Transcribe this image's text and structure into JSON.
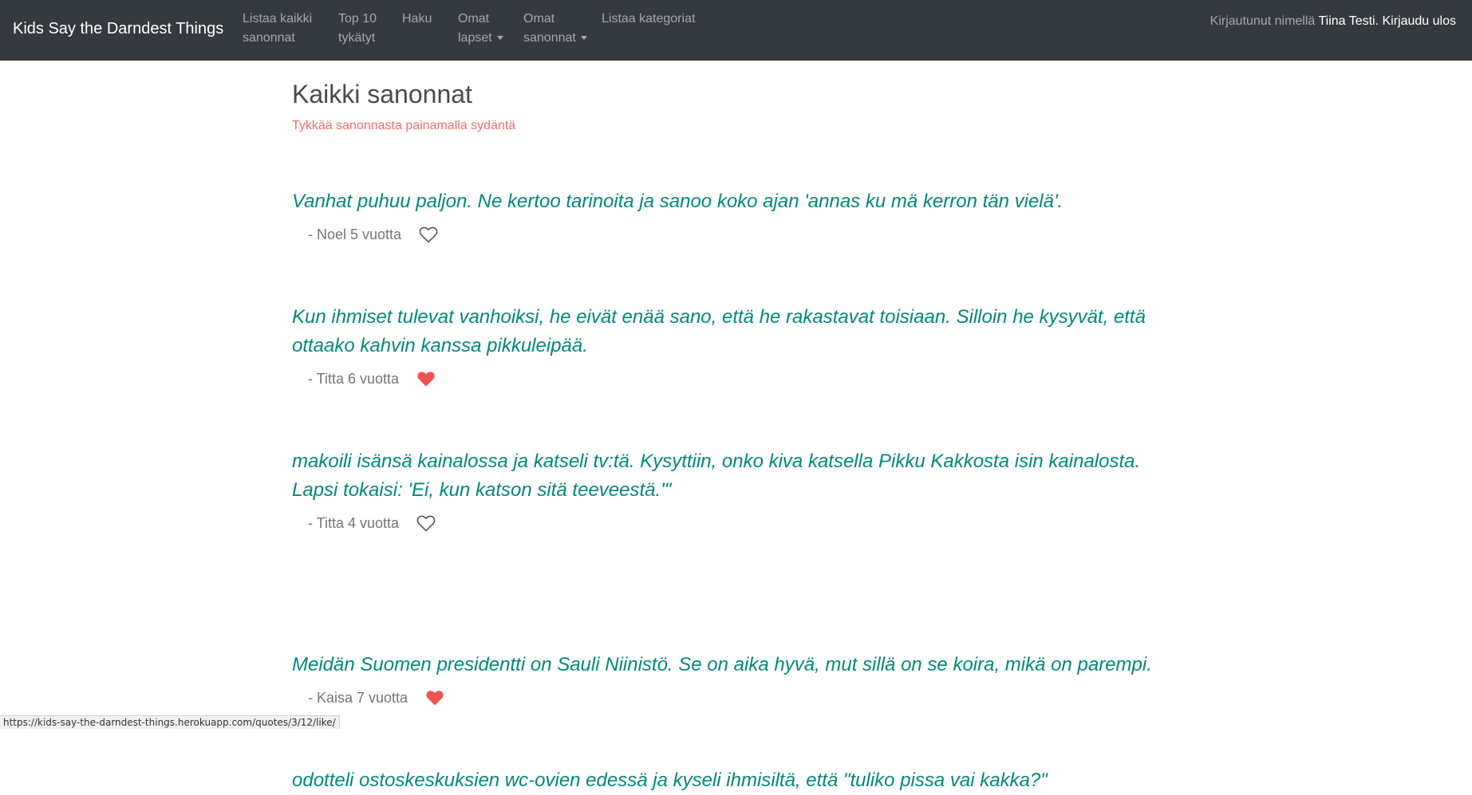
{
  "navbar": {
    "brand": "Kids Say the Darndest Things",
    "links": [
      {
        "line1": "Listaa kaikki",
        "line2": "sanonnat"
      },
      {
        "line1": "Top 10",
        "line2": "tykätyt"
      },
      {
        "line1": "Haku",
        "line2": ""
      },
      {
        "line1": "Omat",
        "line2": "lapset"
      },
      {
        "line1": "Omat",
        "line2": "sanonnat"
      },
      {
        "line1": "Listaa kategoriat",
        "line2": ""
      }
    ],
    "logged_in_prefix": "Kirjautunut nimellä",
    "user_name": "Tiina Testi.",
    "logout": "Kirjaudu ulos"
  },
  "page": {
    "title": "Kaikki sanonnat",
    "subtitle": "Tykkää sanonnasta painamalla sydäntä"
  },
  "quotes": [
    {
      "text": "Vanhat puhuu paljon. Ne kertoo tarinoita ja sanoo koko ajan 'annas ku mä kerron tän vielä'.",
      "author": "- Noel 5 vuotta",
      "liked": false
    },
    {
      "text": "Kun ihmiset tulevat vanhoiksi, he eivät enää sano, että he rakastavat toisiaan. Silloin he kysyvät, että ottaako kahvin kanssa pikkuleipää.",
      "author": "- Titta 6 vuotta",
      "liked": true
    },
    {
      "text": "makoili isänsä kainalossa ja katseli tv:tä. Kysyttiin, onko kiva katsella Pikku Kakkosta isin kainalosta. Lapsi tokaisi: 'Ei, kun katson sitä teeveestä.'\"",
      "author": "- Titta 4 vuotta",
      "liked": false
    },
    {
      "text": "Meidän Suomen presidentti on Sauli Niinistö. Se on aika hyvä, mut sillä on se koira, mikä on parempi.",
      "author": "- Kaisa 7 vuotta",
      "liked": true
    },
    {
      "text": "odotteli ostoskeskuksien wc-ovien edessä ja kyseli ihmisiltä, että \"tuliko pissa vai kakka?\"",
      "author": "",
      "liked": false
    }
  ],
  "statusbar": {
    "url": "https://kids-say-the-darndest-things.herokuapp.com/quotes/3/12/like/"
  },
  "colors": {
    "navbar_bg": "#343a40",
    "quote_text": "#00897b",
    "heart_liked": "#ef5350",
    "subtitle": "#ee6e73"
  }
}
